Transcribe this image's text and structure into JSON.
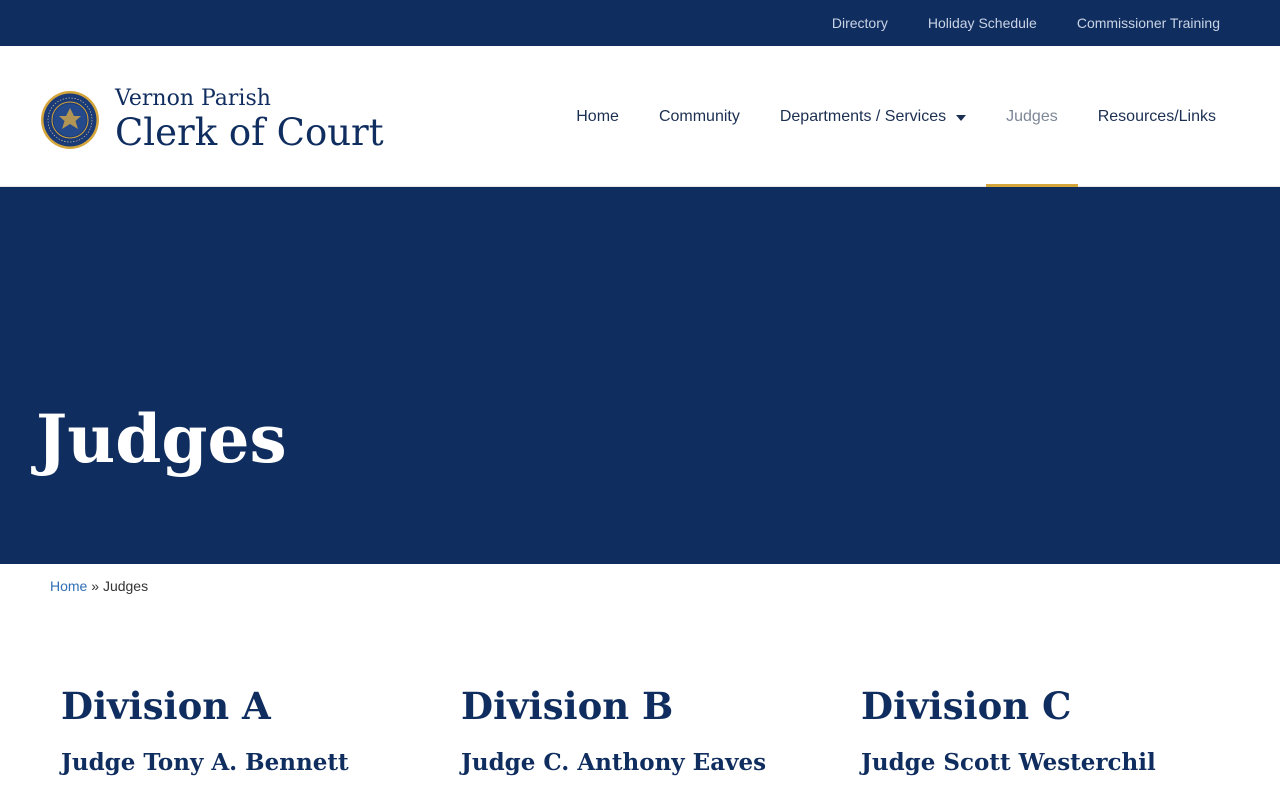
{
  "topbar": {
    "links": [
      "Directory",
      "Holiday Schedule",
      "Commissioner Training"
    ]
  },
  "logo": {
    "subtitle": "Vernon Parish",
    "title": "Clerk of Court"
  },
  "nav": {
    "items": [
      {
        "label": "Home"
      },
      {
        "label": "Community"
      },
      {
        "label": "Departments / Services"
      },
      {
        "label": "Judges"
      },
      {
        "label": "Resources/Links"
      }
    ],
    "active": "Judges"
  },
  "hero": {
    "title": "Judges"
  },
  "breadcrumb": {
    "home": "Home",
    "separator": "»",
    "current": "Judges"
  },
  "divisions": [
    {
      "title": "Division A",
      "judge": "Judge Tony A. Bennett"
    },
    {
      "title": "Division B",
      "judge": "Judge C. Anthony Eaves"
    },
    {
      "title": "Division C",
      "judge": "Judge Scott Westerchil"
    }
  ],
  "colors": {
    "navy": "#0f2d5e",
    "accent_gold": "#d4a53a",
    "link_blue": "#2f6fb5"
  },
  "icons": {
    "seal": "parish-seal-icon",
    "dropdown": "chevron-down-icon"
  }
}
